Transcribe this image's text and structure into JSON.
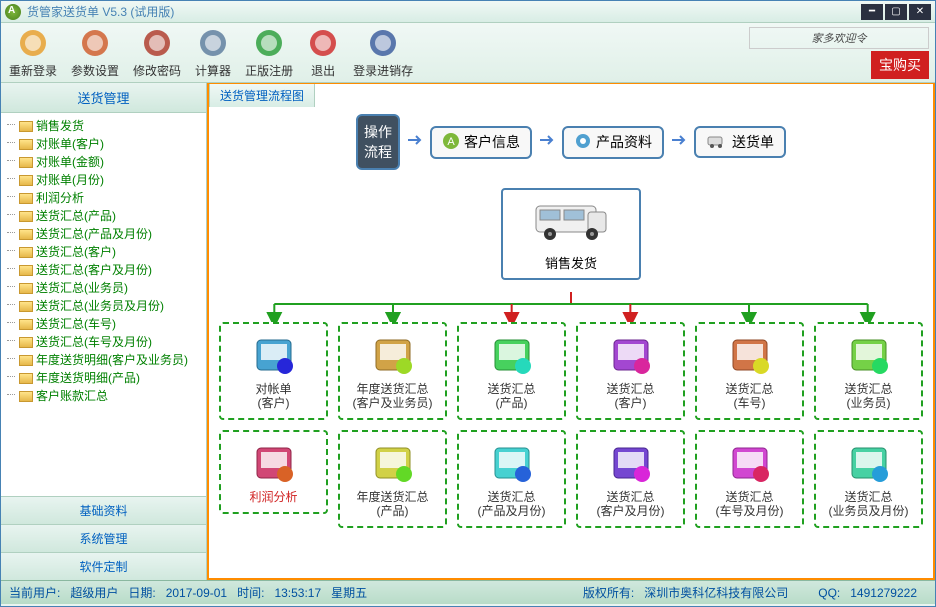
{
  "title": "货管家送货单 V5.3 (试用版)",
  "toolbar": [
    {
      "label": "重新登录",
      "icon": "relogin"
    },
    {
      "label": "参数设置",
      "icon": "settings"
    },
    {
      "label": "修改密码",
      "icon": "password"
    },
    {
      "label": "计算器",
      "icon": "calc"
    },
    {
      "label": "正版注册",
      "icon": "register"
    },
    {
      "label": "退出",
      "icon": "exit"
    },
    {
      "label": "登录进销存",
      "icon": "login-inv"
    }
  ],
  "promo_script": "家多欢迎令",
  "promo_btn": "宝购买",
  "sidebar": {
    "header": "送货管理",
    "items": [
      "销售发货",
      "对账单(客户)",
      "对账单(金额)",
      "对账单(月份)",
      "利润分析",
      "送货汇总(产品)",
      "送货汇总(产品及月份)",
      "送货汇总(客户)",
      "送货汇总(客户及月份)",
      "送货汇总(业务员)",
      "送货汇总(业务员及月份)",
      "送货汇总(车号)",
      "送货汇总(车号及月份)",
      "年度送货明细(客户及业务员)",
      "年度送货明细(产品)",
      "客户账款汇总"
    ],
    "sections": [
      "基础资料",
      "系统管理",
      "软件定制"
    ]
  },
  "content": {
    "tab": "送货管理流程图",
    "process": {
      "start": "操作\n流程",
      "steps": [
        "客户信息",
        "产品资料",
        "送货单"
      ]
    },
    "sales": "销售发货",
    "grid": [
      [
        {
          "l1": "对帐单",
          "l2": "(客户)"
        },
        {
          "l1": "年度送货汇总",
          "l2": "(客户及业务员)"
        },
        {
          "l1": "送货汇总",
          "l2": "(产品)"
        },
        {
          "l1": "送货汇总",
          "l2": "(客户)"
        },
        {
          "l1": "送货汇总",
          "l2": "(车号)"
        },
        {
          "l1": "送货汇总",
          "l2": "(业务员)"
        }
      ],
      [
        {
          "l1": "利润分析",
          "l2": "",
          "red": true
        },
        {
          "l1": "年度送货汇总",
          "l2": "(产品)"
        },
        {
          "l1": "送货汇总",
          "l2": "(产品及月份)"
        },
        {
          "l1": "送货汇总",
          "l2": "(客户及月份)"
        },
        {
          "l1": "送货汇总",
          "l2": "(车号及月份)"
        },
        {
          "l1": "送货汇总",
          "l2": "(业务员及月份)"
        }
      ]
    ]
  },
  "status": {
    "user_label": "当前用户:",
    "user": "超级用户",
    "date_label": "日期:",
    "date": "2017-09-01",
    "time_label": "时间:",
    "time": "13:53:17",
    "weekday": "星期五",
    "copyright_label": "版权所有:",
    "copyright": "深圳市奥科亿科技有限公司",
    "qq_label": "QQ:",
    "qq": "1491279222"
  }
}
